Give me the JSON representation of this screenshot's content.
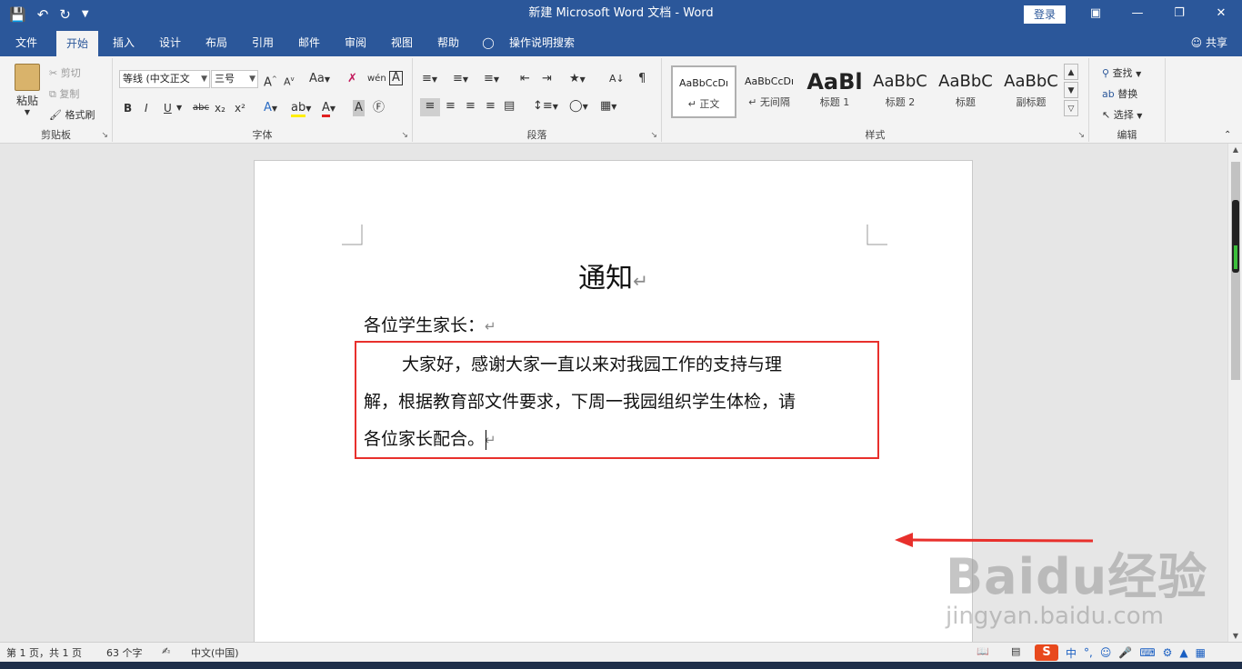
{
  "app": {
    "title": "新建 Microsoft Word 文档  -  Word",
    "login_label": "登录",
    "share_label": "共享",
    "accent_color": "#2b579a"
  },
  "quick_access": {
    "save_icon": "save-icon",
    "undo_icon": "undo-icon",
    "redo_icon": "redo-icon",
    "customize_icon": "customize-qat-icon"
  },
  "tabs": [
    "文件",
    "开始",
    "插入",
    "设计",
    "布局",
    "引用",
    "邮件",
    "审阅",
    "视图",
    "帮助",
    "操作说明搜索"
  ],
  "active_tab": "开始",
  "clipboard": {
    "paste": "粘贴",
    "cut": "剪切",
    "copy": "复制",
    "format_painter": "格式刷",
    "group_label": "剪贴板"
  },
  "font": {
    "font_name": "等线 (中文正文",
    "font_size": "三号",
    "bold": "B",
    "italic": "I",
    "underline": "U",
    "strike": "abc",
    "subscript": "x₂",
    "superscript": "x²",
    "case": "Aa",
    "group_label": "字体"
  },
  "paragraph": {
    "group_label": "段落"
  },
  "styles": {
    "items": [
      {
        "sample": "AaBbCcDı",
        "name": "正文"
      },
      {
        "sample": "AaBbCcDı",
        "name": "无间隔"
      },
      {
        "sample": "AaBl",
        "name": "标题 1"
      },
      {
        "sample": "AaBbC",
        "name": "标题 2"
      },
      {
        "sample": "AaBbC",
        "name": "标题"
      },
      {
        "sample": "AaBbC",
        "name": "副标题"
      }
    ],
    "group_label": "样式"
  },
  "editing": {
    "find": "查找",
    "replace": "替换",
    "select": "选择",
    "group_label": "编辑"
  },
  "document": {
    "title": "通知",
    "salutation": "各位学生家长：",
    "body_line1": "大家好，感谢大家一直以来对我园工作的支持与理",
    "body_line2": "解，根据教育部文件要求，下周一我园组织学生体检，请",
    "body_line3": "各位家长配合。"
  },
  "annotation": {
    "box_color": "#e8302c"
  },
  "watermark": {
    "line1": "Baidu经验",
    "line2": "jingyan.baidu.com"
  },
  "statusbar": {
    "page": "第 1 页，共 1 页",
    "word_count": "63 个字",
    "language": "中文(中国)"
  },
  "ime": {
    "logo": "S",
    "mode": "中",
    "punct": "°,"
  }
}
